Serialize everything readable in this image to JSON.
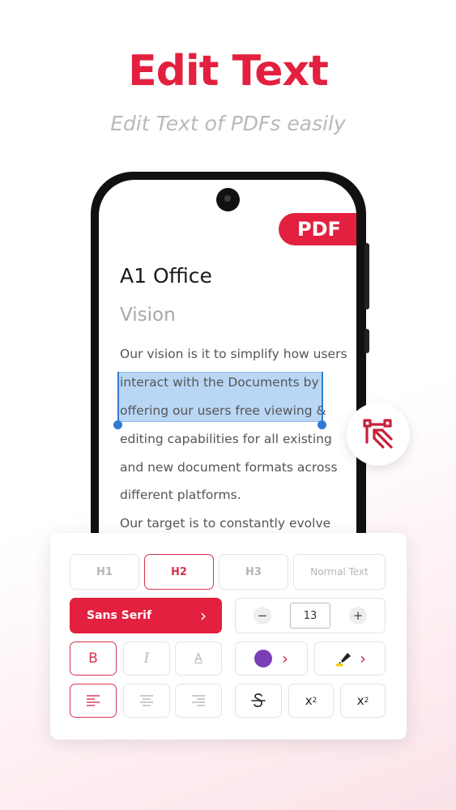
{
  "headline": "Edit Text",
  "subheadline": "Edit Text of PDFs easily",
  "document": {
    "badge": "PDF",
    "title": "A1 Office",
    "subtitle": "Vision",
    "lines": [
      "Our vision is it to simplify how users",
      "interact with the Documents by",
      "offering our users free viewing &",
      "editing capabilities for all existing",
      "and new document formats across",
      "different platforms.",
      "Our target is to constantly evolve"
    ]
  },
  "toolbar": {
    "headings": [
      "H1",
      "H2",
      "H3",
      "Normal Text"
    ],
    "selected_heading": "H2",
    "font": "Sans Serif",
    "font_size": "13",
    "minus": "−",
    "plus": "+",
    "bold": "B",
    "italic": "I",
    "underline": "A",
    "superscript": "x",
    "superscript_mark": "2",
    "subscript": "x",
    "subscript_mark": "2",
    "chevron": "›",
    "text_color": "#7b3fb5"
  },
  "colors": {
    "brand": "#e3203f",
    "selection": "#b9d7f5",
    "handle": "#2f7bd6"
  },
  "icons": {
    "fab": "edit-selection-icon",
    "align_left": "align-left-icon",
    "align_center": "align-center-icon",
    "align_right": "align-right-icon",
    "strike": "strikethrough-icon",
    "highlighter": "highlighter-icon"
  }
}
